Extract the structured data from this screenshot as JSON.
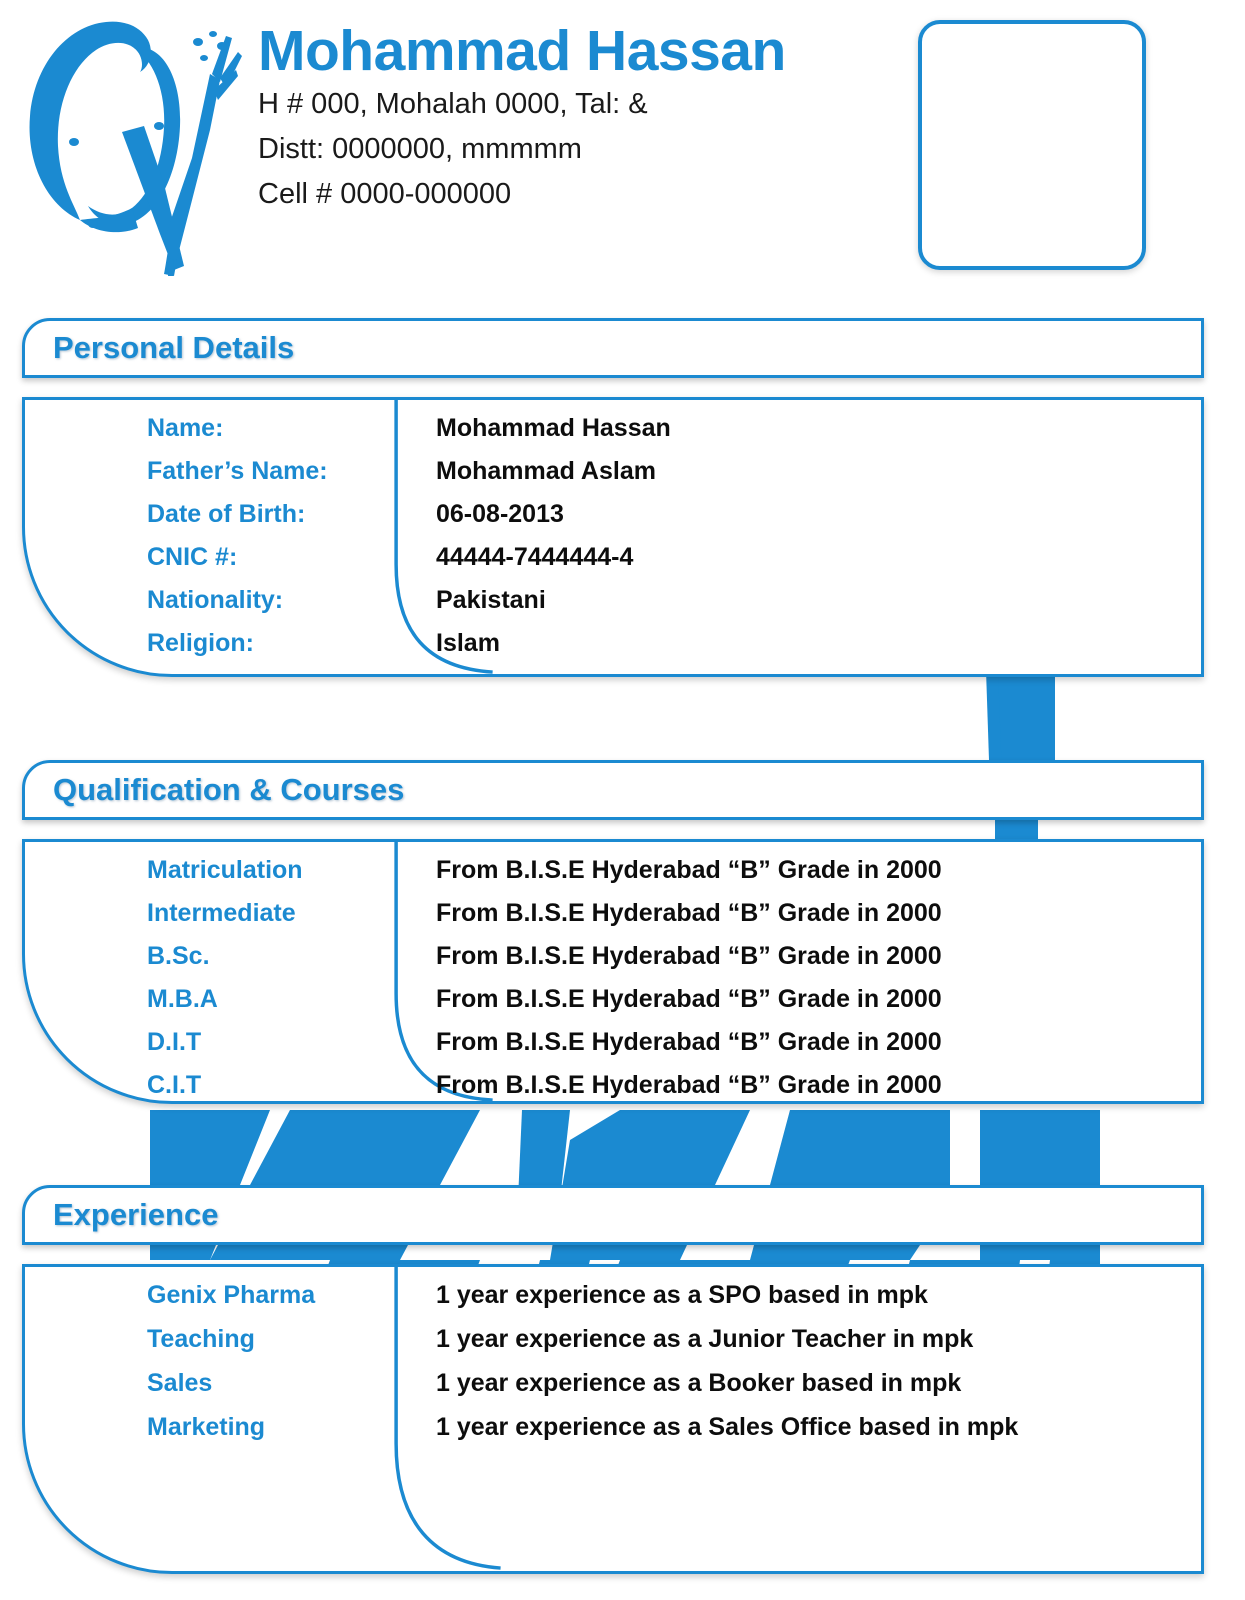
{
  "theme": {
    "accent": "#1b8ad1",
    "text": "#0d0d0d",
    "background": "#ffffff"
  },
  "header": {
    "logo_alt": "cv-brush-logo",
    "full_name": "Mohammad Hassan",
    "address_lines": [
      "H # 000, Mohalah 0000, Tal: &",
      "Distt: 0000000, mmmmm",
      "Cell # 0000-000000"
    ],
    "photo_placeholder_label": ""
  },
  "sections": [
    {
      "id": "personal",
      "title": "Personal Details",
      "rows": [
        {
          "label": "Name:",
          "value": "Mohammad Hassan"
        },
        {
          "label": "Father’s Name:",
          "value": "Mohammad Aslam"
        },
        {
          "label": "Date of Birth:",
          "value": "06-08-2013"
        },
        {
          "label": "CNIC #:",
          "value": "44444-7444444-4"
        },
        {
          "label": "Nationality:",
          "value": "Pakistani"
        },
        {
          "label": "Religion:",
          "value": "Islam"
        }
      ]
    },
    {
      "id": "qualification",
      "title": "Qualification & Courses",
      "rows": [
        {
          "label": "Matriculation",
          "value": "From B.I.S.E Hyderabad “B” Grade in 2000"
        },
        {
          "label": "Intermediate",
          "value": "From B.I.S.E Hyderabad “B” Grade in 2000"
        },
        {
          "label": "B.Sc.",
          "value": "From B.I.S.E Hyderabad “B” Grade in 2000"
        },
        {
          "label": "M.B.A",
          "value": "From B.I.S.E Hyderabad “B” Grade in 2000"
        },
        {
          "label": "D.I.T",
          "value": "From B.I.S.E Hyderabad “B” Grade in 2000"
        },
        {
          "label": "C.I.T",
          "value": "From B.I.S.E Hyderabad “B” Grade in 2000"
        }
      ]
    },
    {
      "id": "experience",
      "title": "Experience",
      "rows": [
        {
          "label": "Genix Pharma",
          "value": "1 year experience as a SPO based in mpk"
        },
        {
          "label": "Teaching",
          "value": "1 year experience as a Junior Teacher in mpk"
        },
        {
          "label": "Sales",
          "value": "1 year experience as a Booker based in mpk"
        },
        {
          "label": "Marketing",
          "value": "1 year experience as a Sales Office  based in mpk"
        }
      ]
    }
  ]
}
